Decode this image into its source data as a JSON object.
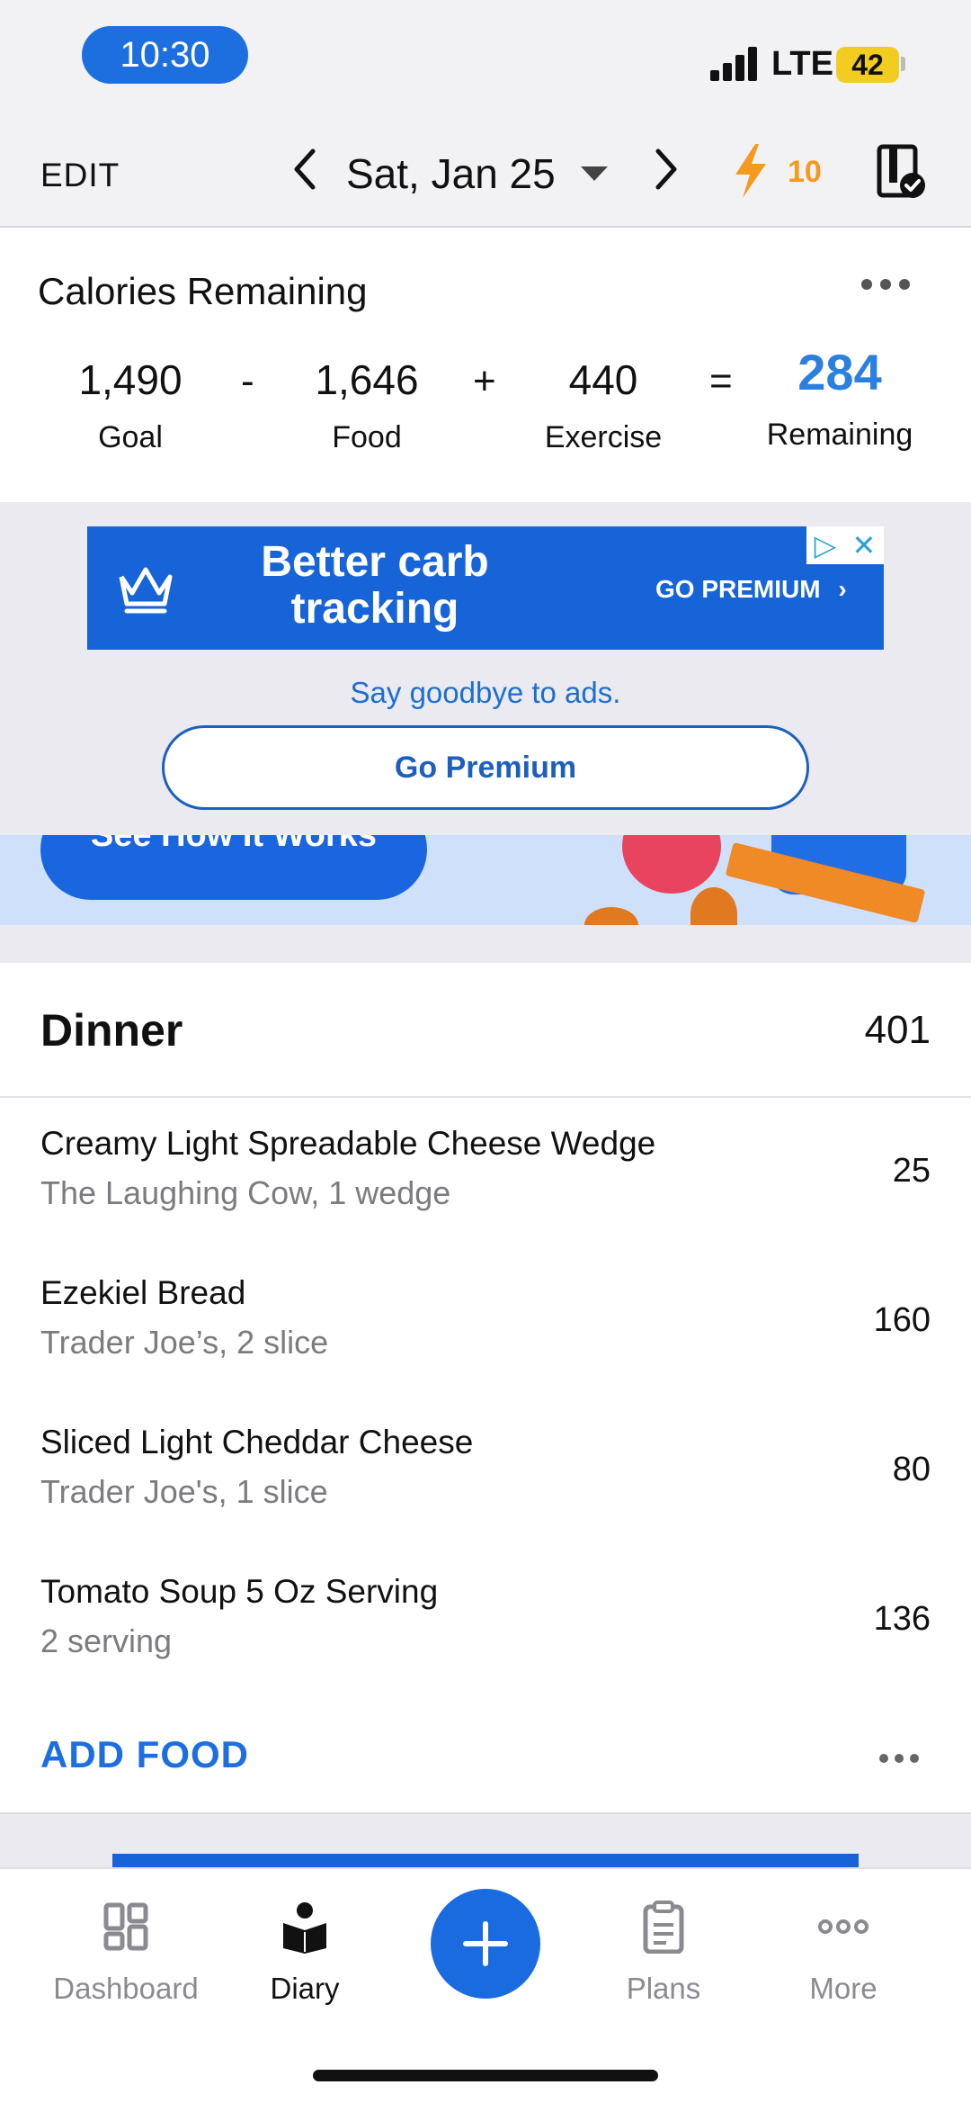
{
  "status_bar": {
    "time": "10:30",
    "network": "LTE",
    "battery": "42"
  },
  "header": {
    "edit_label": "EDIT",
    "date": "Sat, Jan 25",
    "streak": "10",
    "prev_icon": "chevron-left-icon",
    "next_icon": "chevron-right-icon",
    "streak_icon": "lightning-icon"
  },
  "calories": {
    "title": "Calories Remaining",
    "goal_value": "1,490",
    "goal_label": "Goal",
    "minus": "-",
    "food_value": "1,646",
    "food_label": "Food",
    "plus": "+",
    "exercise_value": "440",
    "exercise_label": "Exercise",
    "equals": "=",
    "remaining_value": "284",
    "remaining_label": "Remaining",
    "remaining_color": "#2b7fe0"
  },
  "ad": {
    "headline": "Better carb tracking",
    "cta": "GO PREMIUM",
    "cta_chevron": "›",
    "choices_play": "▷",
    "choices_close": "✕",
    "subtext": "Say goodbye to ads.",
    "button_label": "Go Premium",
    "brand_color": "#1664d8"
  },
  "promo": {
    "button_label": "See How It Works"
  },
  "meal": {
    "name": "Dinner",
    "total": "401",
    "items": [
      {
        "name": "Creamy Light Spreadable Cheese Wedge",
        "detail": "The Laughing Cow, 1 wedge",
        "calories": "25"
      },
      {
        "name": "Ezekiel Bread",
        "detail": "Trader Joe’s, 2 slice",
        "calories": "160"
      },
      {
        "name": "Sliced Light Cheddar Cheese",
        "detail": "Trader Joe's, 1 slice",
        "calories": "80"
      },
      {
        "name": "Tomato Soup 5 Oz Serving",
        "detail": "2 serving",
        "calories": "136"
      }
    ],
    "add_food_label": "ADD FOOD"
  },
  "tab_bar": {
    "dashboard": "Dashboard",
    "diary": "Diary",
    "plans": "Plans",
    "more": "More",
    "active": "diary",
    "accent_color": "#1a6be0"
  }
}
